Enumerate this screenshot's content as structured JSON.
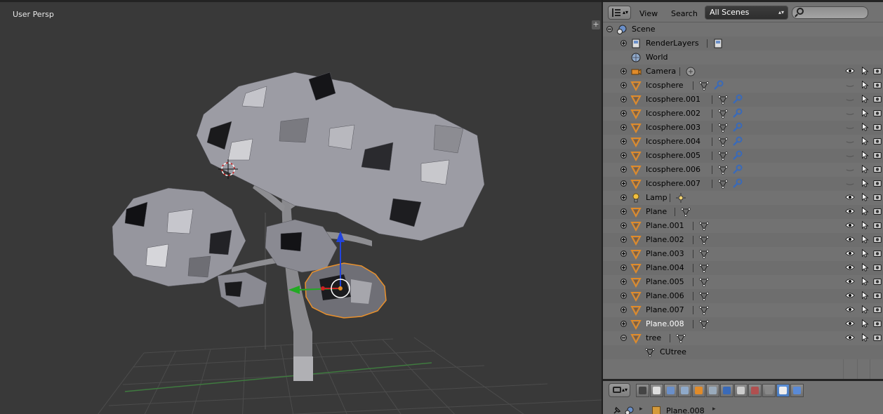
{
  "viewport": {
    "view_label": "User Persp",
    "plus_label": "+"
  },
  "outliner": {
    "menus": {
      "view": "View",
      "search": "Search"
    },
    "scene_select": "All Scenes",
    "search_placeholder": "",
    "rows": [
      {
        "name": "Scene",
        "type": "scene",
        "expand": "minus",
        "indent": 0
      },
      {
        "name": "RenderLayers",
        "type": "renderlayers",
        "expand": "plus",
        "indent": 1
      },
      {
        "name": "World",
        "type": "world",
        "expand": "none",
        "indent": 1
      },
      {
        "name": "Camera",
        "type": "camera",
        "expand": "plus",
        "indent": 1,
        "restrict": true,
        "visible": true
      },
      {
        "name": "Icosphere",
        "type": "mesh",
        "expand": "plus",
        "indent": 1,
        "restrict": true,
        "visible": false,
        "modifier": true
      },
      {
        "name": "Icosphere.001",
        "type": "mesh",
        "expand": "plus",
        "indent": 1,
        "restrict": true,
        "visible": false,
        "modifier": true
      },
      {
        "name": "Icosphere.002",
        "type": "mesh",
        "expand": "plus",
        "indent": 1,
        "restrict": true,
        "visible": false,
        "modifier": true
      },
      {
        "name": "Icosphere.003",
        "type": "mesh",
        "expand": "plus",
        "indent": 1,
        "restrict": true,
        "visible": false,
        "modifier": true
      },
      {
        "name": "Icosphere.004",
        "type": "mesh",
        "expand": "plus",
        "indent": 1,
        "restrict": true,
        "visible": false,
        "modifier": true
      },
      {
        "name": "Icosphere.005",
        "type": "mesh",
        "expand": "plus",
        "indent": 1,
        "restrict": true,
        "visible": false,
        "modifier": true
      },
      {
        "name": "Icosphere.006",
        "type": "mesh",
        "expand": "plus",
        "indent": 1,
        "restrict": true,
        "visible": false,
        "modifier": true
      },
      {
        "name": "Icosphere.007",
        "type": "mesh",
        "expand": "plus",
        "indent": 1,
        "restrict": true,
        "visible": false,
        "modifier": true
      },
      {
        "name": "Lamp",
        "type": "lamp",
        "expand": "plus",
        "indent": 1,
        "restrict": true,
        "visible": true
      },
      {
        "name": "Plane",
        "type": "mesh",
        "expand": "plus",
        "indent": 1,
        "restrict": true,
        "visible": true
      },
      {
        "name": "Plane.001",
        "type": "mesh",
        "expand": "plus",
        "indent": 1,
        "restrict": true,
        "visible": true
      },
      {
        "name": "Plane.002",
        "type": "mesh",
        "expand": "plus",
        "indent": 1,
        "restrict": true,
        "visible": true
      },
      {
        "name": "Plane.003",
        "type": "mesh",
        "expand": "plus",
        "indent": 1,
        "restrict": true,
        "visible": true
      },
      {
        "name": "Plane.004",
        "type": "mesh",
        "expand": "plus",
        "indent": 1,
        "restrict": true,
        "visible": true
      },
      {
        "name": "Plane.005",
        "type": "mesh",
        "expand": "plus",
        "indent": 1,
        "restrict": true,
        "visible": true
      },
      {
        "name": "Plane.006",
        "type": "mesh",
        "expand": "plus",
        "indent": 1,
        "restrict": true,
        "visible": true
      },
      {
        "name": "Plane.007",
        "type": "mesh",
        "expand": "plus",
        "indent": 1,
        "restrict": true,
        "visible": true
      },
      {
        "name": "Plane.008",
        "type": "mesh",
        "expand": "plus",
        "indent": 1,
        "restrict": true,
        "visible": true,
        "selected": true
      },
      {
        "name": "tree",
        "type": "mesh",
        "expand": "minus",
        "indent": 1,
        "restrict": true,
        "visible": true
      },
      {
        "name": "CUtree",
        "type": "meshdata",
        "expand": "none",
        "indent": 2
      }
    ]
  },
  "properties": {
    "breadcrumb_object": "Plane.008",
    "tabs": [
      "render",
      "render-layers",
      "scene",
      "world",
      "object",
      "constraints",
      "modifiers",
      "data",
      "material",
      "texture",
      "particles",
      "physics"
    ],
    "active_tab": "particles"
  },
  "colors": {
    "accent_orange": "#e08b2a",
    "selected_blue": "#5c8fd6",
    "x_axis": "#cc2222",
    "y_axis": "#22aa22",
    "z_axis": "#2244dd"
  }
}
